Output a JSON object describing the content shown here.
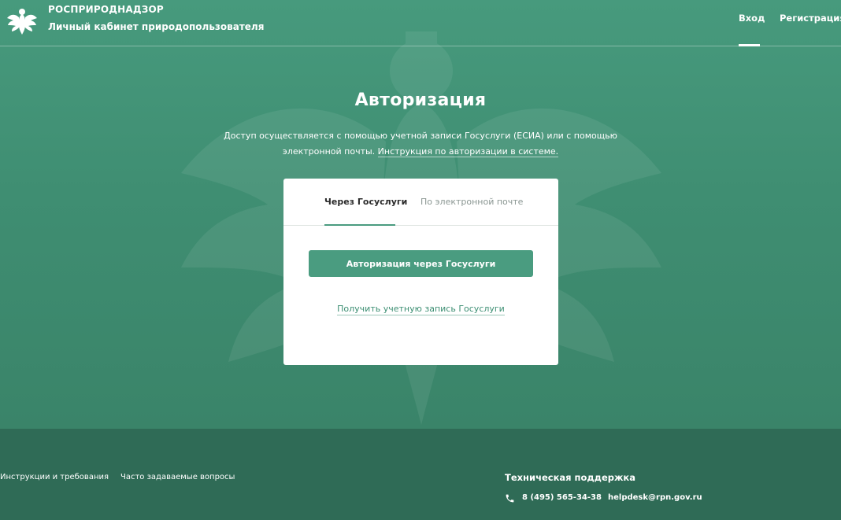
{
  "header": {
    "brand_title": "РОСПРИРОДНАДЗОР",
    "brand_subtitle": "Личный кабинет природопользователя",
    "logo_icon": "eagle-emblem-icon",
    "nav": {
      "login": "Вход",
      "register": "Регистрация"
    }
  },
  "main": {
    "title": "Авторизация",
    "description_prefix": "Доступ осуществляется с помощью учетной записи Госуслуги (ЕСИА) или с помощью электронной почты.",
    "description_link": "Инструкция по авторизации в системе."
  },
  "card": {
    "tabs": [
      {
        "label": "Через Госуслуги",
        "active": true
      },
      {
        "label": "По электронной почте",
        "active": false
      }
    ],
    "auth_button": "Авторизация через Госуслуги",
    "get_account_link": "Получить учетную запись Госуслуги"
  },
  "footer": {
    "links": [
      "Инструкции и требования",
      "Часто задаваемые вопросы"
    ],
    "support_title": "Техническая поддержка",
    "phone_icon": "phone-icon",
    "phone": "8 (495) 565-34-38",
    "email": "helpdesk@rpn.gov.ru"
  },
  "colors": {
    "accent": "#4a9c80",
    "hero": "#479a7d",
    "footer": "#2f6b56",
    "card": "#ffffff"
  }
}
